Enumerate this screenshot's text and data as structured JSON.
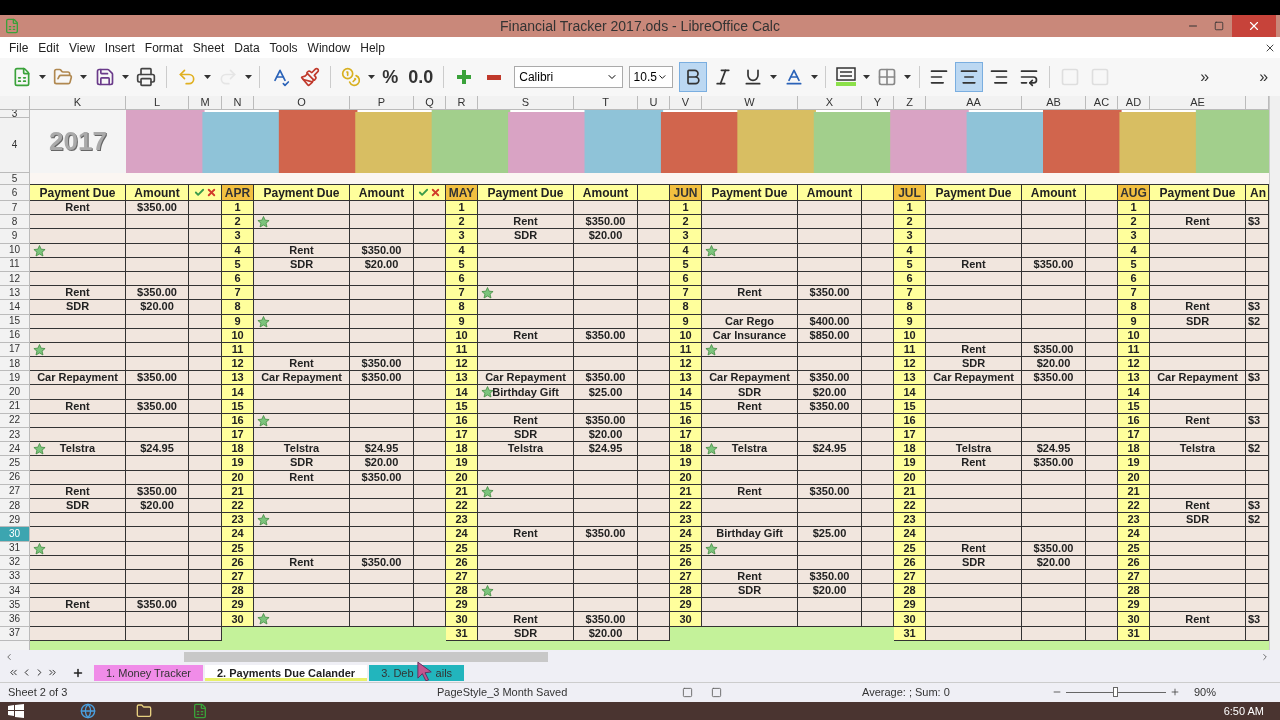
{
  "window": {
    "title": "Financial Tracker 2017.ods - LibreOffice Calc"
  },
  "menu": [
    "File",
    "Edit",
    "View",
    "Insert",
    "Format",
    "Sheet",
    "Data",
    "Tools",
    "Window",
    "Help"
  ],
  "toolbar": [
    {
      "kind": "new",
      "dropdown": true,
      "disabled": false
    },
    {
      "kind": "open",
      "dropdown": true,
      "disabled": false
    },
    {
      "kind": "save",
      "dropdown": true,
      "disabled": false
    },
    {
      "kind": "print",
      "dropdown": false,
      "disabled": false
    },
    {
      "kind": "separator"
    },
    {
      "kind": "undo",
      "dropdown": true,
      "disabled": false
    },
    {
      "kind": "redo",
      "dropdown": true,
      "disabled": true
    },
    {
      "kind": "separator"
    },
    {
      "kind": "spellcheck",
      "dropdown": false,
      "disabled": false
    },
    {
      "kind": "clone",
      "dropdown": false,
      "disabled": false
    },
    {
      "kind": "separator"
    },
    {
      "kind": "currency",
      "dropdown": true,
      "disabled": false
    },
    {
      "kind": "text",
      "text": "%",
      "disabled": false
    },
    {
      "kind": "text",
      "text": "0.0",
      "disabled": false
    },
    {
      "kind": "separator"
    },
    {
      "kind": "add_decimal",
      "dropdown": false,
      "disabled": false
    },
    {
      "kind": "delete_decimal",
      "dropdown": false,
      "disabled": false
    },
    {
      "kind": "font",
      "value": "Calibri"
    },
    {
      "kind": "size",
      "value": "10.5"
    },
    {
      "kind": "bold",
      "selected": true,
      "disabled": false
    },
    {
      "kind": "italic",
      "selected": false,
      "disabled": false
    },
    {
      "kind": "underline",
      "selected": false,
      "dropdown": true,
      "disabled": false
    },
    {
      "kind": "font_color",
      "dropdown": true,
      "disabled": false
    },
    {
      "kind": "separator"
    },
    {
      "kind": "background_color",
      "dropdown": true,
      "disabled": false
    },
    {
      "kind": "borders",
      "dropdown": true,
      "disabled": false
    },
    {
      "kind": "separator"
    },
    {
      "kind": "align_left",
      "selected": false,
      "disabled": false
    },
    {
      "kind": "align_center",
      "selected": true,
      "disabled": false
    },
    {
      "kind": "align_right",
      "selected": false,
      "disabled": false
    },
    {
      "kind": "wrap",
      "selected": false,
      "disabled": false
    },
    {
      "kind": "separator"
    },
    {
      "kind": "merge",
      "disabled": true
    },
    {
      "kind": "unmerge",
      "disabled": true
    },
    {
      "kind": "more",
      "text": "»"
    },
    {
      "kind": "more",
      "text": "»"
    }
  ],
  "column_letters": [
    "K",
    "L",
    "M",
    "N",
    "O",
    "P",
    "Q",
    "R",
    "S",
    "T",
    "U",
    "V",
    "W",
    "X",
    "Y",
    "Z",
    "AA",
    "AB",
    "AC",
    "AD",
    "AE"
  ],
  "row_numbers": [
    {
      "label": "3",
      "selected": false
    },
    {
      "label": "4",
      "selected": false
    },
    {
      "label": "5",
      "selected": false
    },
    {
      "label": "6",
      "selected": false
    },
    {
      "label": "7",
      "selected": false
    },
    {
      "label": "8",
      "selected": false
    },
    {
      "label": "9",
      "selected": false
    },
    {
      "label": "10",
      "selected": false
    },
    {
      "label": "11",
      "selected": false
    },
    {
      "label": "12",
      "selected": false
    },
    {
      "label": "13",
      "selected": false
    },
    {
      "label": "14",
      "selected": false
    },
    {
      "label": "15",
      "selected": false
    },
    {
      "label": "16",
      "selected": false
    },
    {
      "label": "17",
      "selected": false
    },
    {
      "label": "18",
      "selected": false
    },
    {
      "label": "19",
      "selected": false
    },
    {
      "label": "20",
      "selected": false
    },
    {
      "label": "21",
      "selected": false
    },
    {
      "label": "22",
      "selected": false
    },
    {
      "label": "23",
      "selected": false
    },
    {
      "label": "24",
      "selected": false
    },
    {
      "label": "25",
      "selected": false
    },
    {
      "label": "26",
      "selected": false
    },
    {
      "label": "27",
      "selected": false
    },
    {
      "label": "28",
      "selected": false
    },
    {
      "label": "29",
      "selected": false
    },
    {
      "label": "30",
      "selected": true
    },
    {
      "label": "31",
      "selected": false
    },
    {
      "label": "32",
      "selected": false
    },
    {
      "label": "33",
      "selected": false
    },
    {
      "label": "34",
      "selected": false
    },
    {
      "label": "35",
      "selected": false
    },
    {
      "label": "36",
      "selected": false
    },
    {
      "label": "37",
      "selected": false
    }
  ],
  "banner": {
    "year": "2017",
    "kind": "picture"
  },
  "blocks": [
    {
      "kind": "no_day",
      "headers": [
        "Payment Due",
        "Amount"
      ],
      "check_icons": true,
      "rows": [
        {
          "star": false,
          "payment": "Rent",
          "amount": "$350.00"
        },
        {
          "star": false
        },
        {
          "star": false
        },
        {
          "star": true
        },
        {
          "star": false
        },
        {
          "star": false
        },
        {
          "star": false,
          "payment": "Rent",
          "amount": "$350.00"
        },
        {
          "star": false,
          "payment": "SDR",
          "amount": "$20.00"
        },
        {
          "star": false
        },
        {
          "star": false
        },
        {
          "star": true
        },
        {
          "star": false
        },
        {
          "star": false,
          "payment": "Car Repayment",
          "amount": "$350.00"
        },
        {
          "star": false
        },
        {
          "star": false,
          "payment": "Rent",
          "amount": "$350.00"
        },
        {
          "star": false
        },
        {
          "star": false
        },
        {
          "star": true,
          "payment": "Telstra",
          "amount": "$24.95"
        },
        {
          "star": false
        },
        {
          "star": false
        },
        {
          "star": false,
          "payment": "Rent",
          "amount": "$350.00"
        },
        {
          "star": false,
          "payment": "SDR",
          "amount": "$20.00"
        },
        {
          "star": false
        },
        {
          "star": false
        },
        {
          "star": true
        },
        {
          "star": false
        },
        {
          "star": false
        },
        {
          "star": false
        },
        {
          "star": false,
          "payment": "Rent",
          "amount": "$350.00"
        },
        {
          "star": false
        },
        {
          "star": false
        }
      ]
    },
    {
      "kind": "full",
      "month": "APR",
      "headers": [
        "Payment Due",
        "Amount"
      ],
      "check_icons": true,
      "rows": [
        {
          "day": "1",
          "star": false
        },
        {
          "day": "2",
          "star": true
        },
        {
          "day": "3",
          "star": false
        },
        {
          "day": "4",
          "star": false,
          "payment": "Rent",
          "amount": "$350.00"
        },
        {
          "day": "5",
          "star": false,
          "payment": "SDR",
          "amount": "$20.00"
        },
        {
          "day": "6",
          "star": false
        },
        {
          "day": "7",
          "star": false
        },
        {
          "day": "8",
          "star": false
        },
        {
          "day": "9",
          "star": true
        },
        {
          "day": "10",
          "star": false
        },
        {
          "day": "11",
          "star": false
        },
        {
          "day": "12",
          "star": false,
          "payment": "Rent",
          "amount": "$350.00"
        },
        {
          "day": "13",
          "star": false,
          "payment": "Car Repayment",
          "amount": "$350.00"
        },
        {
          "day": "14",
          "star": false
        },
        {
          "day": "15",
          "star": false
        },
        {
          "day": "16",
          "star": true
        },
        {
          "day": "17",
          "star": false
        },
        {
          "day": "18",
          "star": false,
          "payment": "Telstra",
          "amount": "$24.95"
        },
        {
          "day": "19",
          "star": false,
          "payment": "SDR",
          "amount": "$20.00"
        },
        {
          "day": "20",
          "star": false,
          "payment": "Rent",
          "amount": "$350.00"
        },
        {
          "day": "21",
          "star": false
        },
        {
          "day": "22",
          "star": false
        },
        {
          "day": "23",
          "star": true
        },
        {
          "day": "24",
          "star": false
        },
        {
          "day": "25",
          "star": false
        },
        {
          "day": "26",
          "star": false,
          "payment": "Rent",
          "amount": "$350.00"
        },
        {
          "day": "27",
          "star": false
        },
        {
          "day": "28",
          "star": false
        },
        {
          "day": "29",
          "star": false
        },
        {
          "day": "30",
          "star": true
        }
      ]
    },
    {
      "kind": "full",
      "month": "MAY",
      "headers": [
        "Payment Due",
        "Amount"
      ],
      "check_icons": false,
      "rows": [
        {
          "day": "1",
          "star": false
        },
        {
          "day": "2",
          "star": false,
          "payment": "Rent",
          "amount": "$350.00"
        },
        {
          "day": "3",
          "star": false,
          "payment": "SDR",
          "amount": "$20.00"
        },
        {
          "day": "4",
          "star": false
        },
        {
          "day": "5",
          "star": false
        },
        {
          "day": "6",
          "star": false
        },
        {
          "day": "7",
          "star": true
        },
        {
          "day": "8",
          "star": false
        },
        {
          "day": "9",
          "star": false
        },
        {
          "day": "10",
          "star": false,
          "payment": "Rent",
          "amount": "$350.00"
        },
        {
          "day": "11",
          "star": false
        },
        {
          "day": "12",
          "star": false
        },
        {
          "day": "13",
          "star": false,
          "payment": "Car Repayment",
          "amount": "$350.00"
        },
        {
          "day": "14",
          "star": true,
          "payment": "Birthday Gift",
          "amount": "$25.00"
        },
        {
          "day": "15",
          "star": false
        },
        {
          "day": "16",
          "star": false,
          "payment": "Rent",
          "amount": "$350.00"
        },
        {
          "day": "17",
          "star": false,
          "payment": "SDR",
          "amount": "$20.00"
        },
        {
          "day": "18",
          "star": false,
          "payment": "Telstra",
          "amount": "$24.95"
        },
        {
          "day": "19",
          "star": false
        },
        {
          "day": "20",
          "star": false
        },
        {
          "day": "21",
          "star": true
        },
        {
          "day": "22",
          "star": false
        },
        {
          "day": "23",
          "star": false
        },
        {
          "day": "24",
          "star": false,
          "payment": "Rent",
          "amount": "$350.00"
        },
        {
          "day": "25",
          "star": false
        },
        {
          "day": "26",
          "star": false
        },
        {
          "day": "27",
          "star": false
        },
        {
          "day": "28",
          "star": true
        },
        {
          "day": "29",
          "star": false
        },
        {
          "day": "30",
          "star": false,
          "payment": "Rent",
          "amount": "$350.00"
        },
        {
          "day": "31",
          "star": false,
          "payment": "SDR",
          "amount": "$20.00"
        }
      ]
    },
    {
      "kind": "full",
      "month": "JUN",
      "headers": [
        "Payment Due",
        "Amount"
      ],
      "check_icons": false,
      "rows": [
        {
          "day": "1",
          "star": false
        },
        {
          "day": "2",
          "star": false
        },
        {
          "day": "3",
          "star": false
        },
        {
          "day": "4",
          "star": true
        },
        {
          "day": "5",
          "star": false
        },
        {
          "day": "6",
          "star": false
        },
        {
          "day": "7",
          "star": false,
          "payment": "Rent",
          "amount": "$350.00"
        },
        {
          "day": "8",
          "star": false
        },
        {
          "day": "9",
          "star": false,
          "payment": "Car Rego",
          "amount": "$400.00"
        },
        {
          "day": "10",
          "star": false,
          "payment": "Car Insurance",
          "amount": "$850.00"
        },
        {
          "day": "11",
          "star": true
        },
        {
          "day": "12",
          "star": false
        },
        {
          "day": "13",
          "star": false,
          "payment": "Car Repayment",
          "amount": "$350.00"
        },
        {
          "day": "14",
          "star": false,
          "payment": "SDR",
          "amount": "$20.00"
        },
        {
          "day": "15",
          "star": false,
          "payment": "Rent",
          "amount": "$350.00"
        },
        {
          "day": "16",
          "star": false
        },
        {
          "day": "17",
          "star": false
        },
        {
          "day": "18",
          "star": true,
          "payment": "Telstra",
          "amount": "$24.95"
        },
        {
          "day": "19",
          "star": false
        },
        {
          "day": "20",
          "star": false
        },
        {
          "day": "21",
          "star": false,
          "payment": "Rent",
          "amount": "$350.00"
        },
        {
          "day": "22",
          "star": false
        },
        {
          "day": "23",
          "star": false
        },
        {
          "day": "24",
          "star": false,
          "payment": "Birthday Gift",
          "amount": "$25.00"
        },
        {
          "day": "25",
          "star": true
        },
        {
          "day": "26",
          "star": false
        },
        {
          "day": "27",
          "star": false,
          "payment": "Rent",
          "amount": "$350.00"
        },
        {
          "day": "28",
          "star": false,
          "payment": "SDR",
          "amount": "$20.00"
        },
        {
          "day": "29",
          "star": false
        },
        {
          "day": "30",
          "star": false
        }
      ]
    },
    {
      "kind": "full",
      "month": "JUL",
      "headers": [
        "Payment Due",
        "Amount"
      ],
      "check_icons": false,
      "rows": [
        {
          "day": "1",
          "star": false
        },
        {
          "day": "2",
          "star": false
        },
        {
          "day": "3",
          "star": false
        },
        {
          "day": "4",
          "star": false
        },
        {
          "day": "5",
          "star": false,
          "payment": "Rent",
          "amount": "$350.00"
        },
        {
          "day": "6",
          "star": false
        },
        {
          "day": "7",
          "star": false
        },
        {
          "day": "8",
          "star": false
        },
        {
          "day": "9",
          "star": false
        },
        {
          "day": "10",
          "star": false
        },
        {
          "day": "11",
          "star": false,
          "payment": "Rent",
          "amount": "$350.00"
        },
        {
          "day": "12",
          "star": false,
          "payment": "SDR",
          "amount": "$20.00"
        },
        {
          "day": "13",
          "star": false,
          "payment": "Car Repayment",
          "amount": "$350.00"
        },
        {
          "day": "14",
          "star": false
        },
        {
          "day": "15",
          "star": false
        },
        {
          "day": "16",
          "star": false
        },
        {
          "day": "17",
          "star": false
        },
        {
          "day": "18",
          "star": false,
          "payment": "Telstra",
          "amount": "$24.95"
        },
        {
          "day": "19",
          "star": false,
          "payment": "Rent",
          "amount": "$350.00"
        },
        {
          "day": "20",
          "star": false
        },
        {
          "day": "21",
          "star": false
        },
        {
          "day": "22",
          "star": false
        },
        {
          "day": "23",
          "star": false
        },
        {
          "day": "24",
          "star": false
        },
        {
          "day": "25",
          "star": false,
          "payment": "Rent",
          "amount": "$350.00"
        },
        {
          "day": "26",
          "star": false,
          "payment": "SDR",
          "amount": "$20.00"
        },
        {
          "day": "27",
          "star": false
        },
        {
          "day": "28",
          "star": false
        },
        {
          "day": "29",
          "star": false
        },
        {
          "day": "30",
          "star": false
        },
        {
          "day": "31",
          "star": false
        }
      ]
    },
    {
      "kind": "cut",
      "month": "AUG",
      "headers": [
        "Payment Due",
        "An"
      ],
      "rows": [
        {
          "day": "1",
          "star": false
        },
        {
          "day": "2",
          "star": false,
          "payment": "Rent",
          "amount": "$3"
        },
        {
          "day": "3",
          "star": false
        },
        {
          "day": "4",
          "star": false
        },
        {
          "day": "5",
          "star": false
        },
        {
          "day": "6",
          "star": false
        },
        {
          "day": "7",
          "star": false
        },
        {
          "day": "8",
          "star": false,
          "payment": "Rent",
          "amount": "$3"
        },
        {
          "day": "9",
          "star": false,
          "payment": "SDR",
          "amount": "$2"
        },
        {
          "day": "10",
          "star": false
        },
        {
          "day": "11",
          "star": false
        },
        {
          "day": "12",
          "star": false
        },
        {
          "day": "13",
          "star": false,
          "payment": "Car Repayment",
          "amount": "$3"
        },
        {
          "day": "14",
          "star": false
        },
        {
          "day": "15",
          "star": false
        },
        {
          "day": "16",
          "star": false,
          "payment": "Rent",
          "amount": "$3"
        },
        {
          "day": "17",
          "star": false
        },
        {
          "day": "18",
          "star": false,
          "payment": "Telstra",
          "amount": "$2"
        },
        {
          "day": "19",
          "star": false
        },
        {
          "day": "20",
          "star": false
        },
        {
          "day": "21",
          "star": false
        },
        {
          "day": "22",
          "star": false,
          "payment": "Rent",
          "amount": "$3"
        },
        {
          "day": "23",
          "star": false,
          "payment": "SDR",
          "amount": "$2"
        },
        {
          "day": "24",
          "star": false
        },
        {
          "day": "25",
          "star": false
        },
        {
          "day": "26",
          "star": false
        },
        {
          "day": "27",
          "star": false
        },
        {
          "day": "28",
          "star": false
        },
        {
          "day": "29",
          "star": false
        },
        {
          "day": "30",
          "star": false,
          "payment": "Rent",
          "amount": "$3"
        },
        {
          "day": "31",
          "star": false
        }
      ]
    }
  ],
  "sheet_tabs": [
    {
      "label": "1. Money Tracker",
      "color": "#f08ce8",
      "selected": false
    },
    {
      "label": "2. Payments Due Calander",
      "color": "#e8f06a",
      "selected": true
    },
    {
      "label": "3. Deb",
      "label_end": "ails",
      "color": "#22b5bd",
      "selected": false
    }
  ],
  "status_bar": {
    "sheet": "Sheet 2 of 3",
    "page_style": "PageStyle_3 Month Saved",
    "summary": "Average: ; Sum: 0",
    "zoom": {
      "level": 0.47,
      "reading": "90%"
    }
  },
  "taskbar": {
    "time": "6:50 AM"
  }
}
